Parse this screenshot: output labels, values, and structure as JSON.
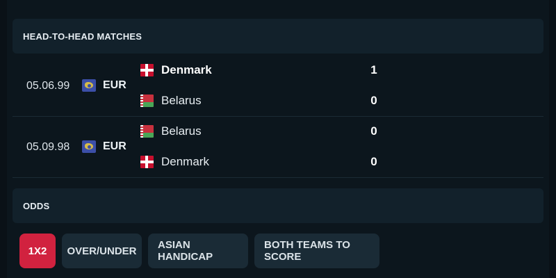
{
  "h2h": {
    "title": "HEAD-TO-HEAD MATCHES",
    "matches": [
      {
        "date": "05.06.99",
        "competition": "EUR",
        "competition_icon": "world-map-icon",
        "home": {
          "name": "Denmark",
          "flag": "denmark-flag",
          "score": "1",
          "winner": true
        },
        "away": {
          "name": "Belarus",
          "flag": "belarus-flag",
          "score": "0",
          "winner": false
        }
      },
      {
        "date": "05.09.98",
        "competition": "EUR",
        "competition_icon": "world-map-icon",
        "home": {
          "name": "Belarus",
          "flag": "belarus-flag",
          "score": "0",
          "winner": false
        },
        "away": {
          "name": "Denmark",
          "flag": "denmark-flag",
          "score": "0",
          "winner": false
        }
      }
    ]
  },
  "odds": {
    "title": "ODDS",
    "tabs": [
      "1X2",
      "OVER/UNDER",
      "ASIAN HANDICAP",
      "BOTH TEAMS TO SCORE"
    ],
    "active_tab": "1X2"
  },
  "colors": {
    "background": "#0c161d",
    "header_bg": "#12212b",
    "tab_bg": "#1a2b36",
    "accent": "#d1223f"
  }
}
